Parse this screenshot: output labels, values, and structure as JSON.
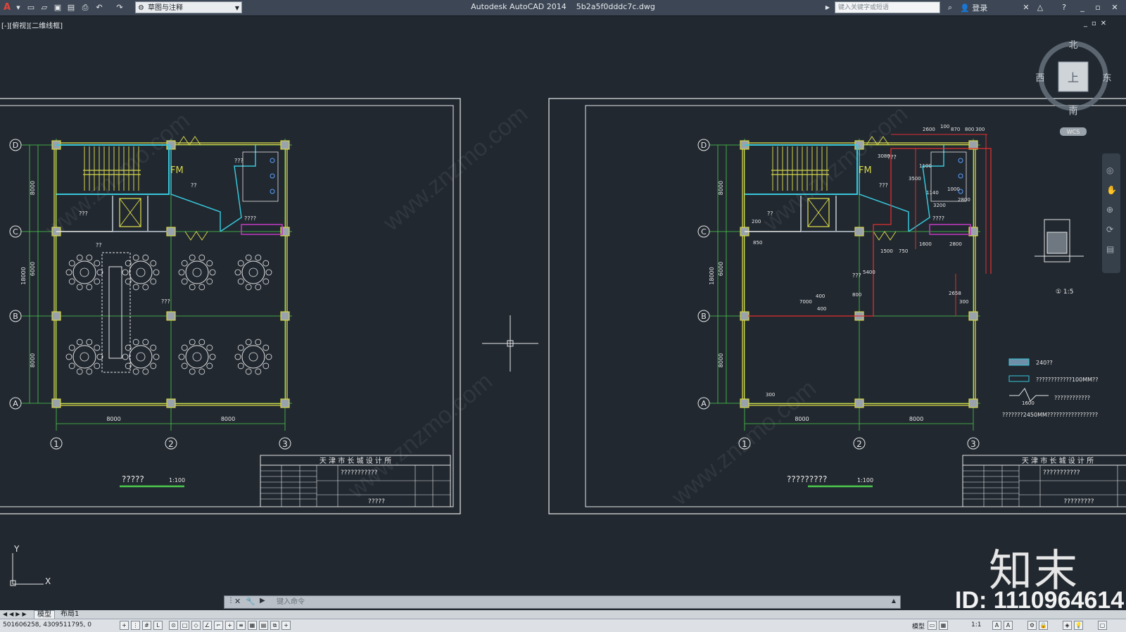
{
  "titlebar": {
    "workspace": "草图与注释",
    "title": "Autodesk AutoCAD 2014",
    "filename": "5b2a5f0dddc7c.dwg",
    "search_placeholder": "键入关键字或短语",
    "login": "登录"
  },
  "viewport": {
    "label": "[-][俯视][二维线框]"
  },
  "viewcube": {
    "north": "北",
    "south": "南",
    "east": "东",
    "west": "西",
    "top": "上",
    "wcs": "WCS"
  },
  "drawing_left": {
    "grid_rows": [
      "D",
      "C",
      "B",
      "A"
    ],
    "grid_cols": [
      "1",
      "2",
      "3"
    ],
    "dims_vertical": [
      "8000",
      "6000",
      "18000",
      "8000"
    ],
    "dims_horizontal": [
      "8000",
      "8000"
    ],
    "room_labels": [
      "FM",
      "??",
      "???",
      "???",
      "????",
      "??",
      "???"
    ],
    "title": "?????",
    "scale": "1:100",
    "titleblock": {
      "company": "天 津 市 长 城 设 计 所",
      "project": "???????????",
      "drawing": "?????"
    }
  },
  "drawing_right": {
    "grid_rows": [
      "D",
      "C",
      "B",
      "A"
    ],
    "grid_cols": [
      "1",
      "2",
      "3"
    ],
    "dims_vertical": [
      "8000",
      "6000",
      "18000",
      "8000"
    ],
    "dims_horizontal": [
      "8000",
      "8000"
    ],
    "red_dims": [
      "2600",
      "100",
      "870",
      "800",
      "300",
      "3080",
      "1100",
      "3500",
      "1000",
      "1140",
      "3200",
      "2800",
      "1500",
      "750",
      "1600",
      "2800",
      "7000",
      "400",
      "800",
      "400",
      "200",
      "850",
      "5400",
      "2658",
      "300",
      "300"
    ],
    "room_labels": [
      "FM",
      "???",
      "??",
      "???",
      "????"
    ],
    "title": "?????????",
    "scale": "1:100",
    "detail_scale": "1:5",
    "legend": [
      "240??",
      "????????????100MM??",
      "????????????"
    ],
    "legend_dim": "1600",
    "note": "???????2450MM?????????????????",
    "titleblock": {
      "company": "天 津 市 长 城 设 计 所",
      "project": "???????????",
      "drawing": "?????????"
    }
  },
  "commandline": {
    "placeholder": "键入命令"
  },
  "tabs": {
    "model": "模型",
    "layout1": "布局1"
  },
  "status": {
    "coords": "501606258, 4309511795, 0",
    "model": "模型",
    "scale": "1:1"
  },
  "watermark": {
    "brand": "知末",
    "id": "ID: 1110964614",
    "site": "www.znzmo.com"
  },
  "colors": {
    "background": "#212830",
    "wall": "#d6d64a",
    "grid": "#4ccc4c",
    "dim_red": "#e03030",
    "cyan": "#38c6d9"
  }
}
